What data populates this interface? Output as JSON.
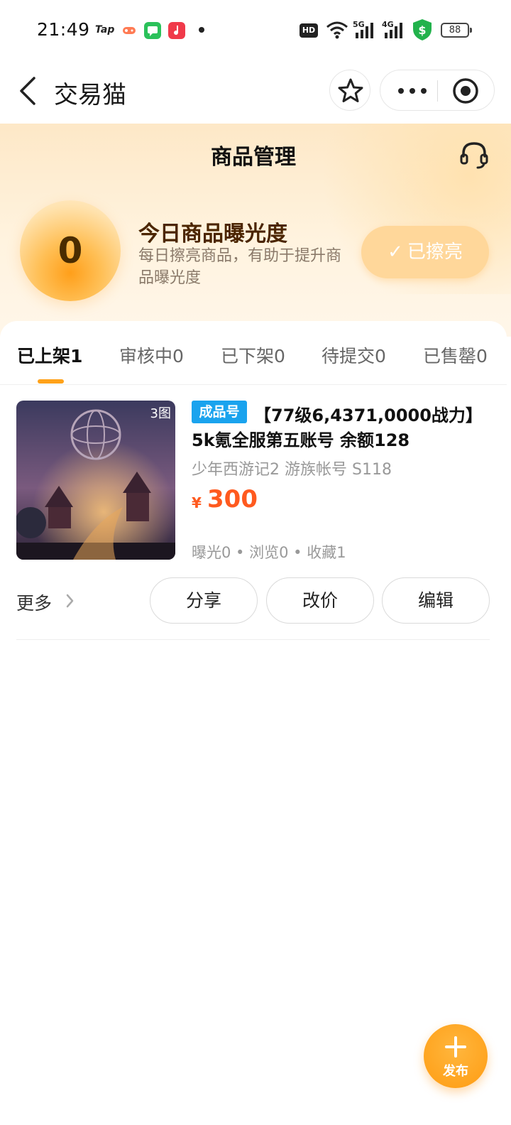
{
  "status_bar": {
    "time": "21:49",
    "tap_label": "Tap",
    "hd_label": "HD",
    "network_5g": "5G",
    "network_4g": "4G",
    "battery": "88"
  },
  "title_bar": {
    "title": "交易猫"
  },
  "hero": {
    "title": "商品管理",
    "score": "0",
    "exposure_title": "今日商品曝光度",
    "exposure_desc": "每日擦亮商品，有助于提升商品曝光度",
    "polished_label": "已擦亮"
  },
  "tabs": [
    {
      "label": "已上架1",
      "active": true
    },
    {
      "label": "审核中0",
      "active": false
    },
    {
      "label": "已下架0",
      "active": false
    },
    {
      "label": "待提交0",
      "active": false
    },
    {
      "label": "已售罄0",
      "active": false
    }
  ],
  "product": {
    "image_count": "3图",
    "tag": "成品号",
    "title_line1": "【77级6,4371,0000战力】",
    "title_line2": "5k氪全服第五账号 余额128",
    "meta": "少年西游记2  游族帐号  S118",
    "price_symbol": "¥",
    "price": "300",
    "stats": "曝光0 • 浏览0 • 收藏1"
  },
  "actions": {
    "more_label": "更多",
    "share_label": "分享",
    "reprice_label": "改价",
    "edit_label": "编辑"
  },
  "fab": {
    "label": "发布"
  },
  "colors": {
    "accent": "#ffa21a",
    "price": "#ff5a1f",
    "tag": "#1aa3ee"
  }
}
